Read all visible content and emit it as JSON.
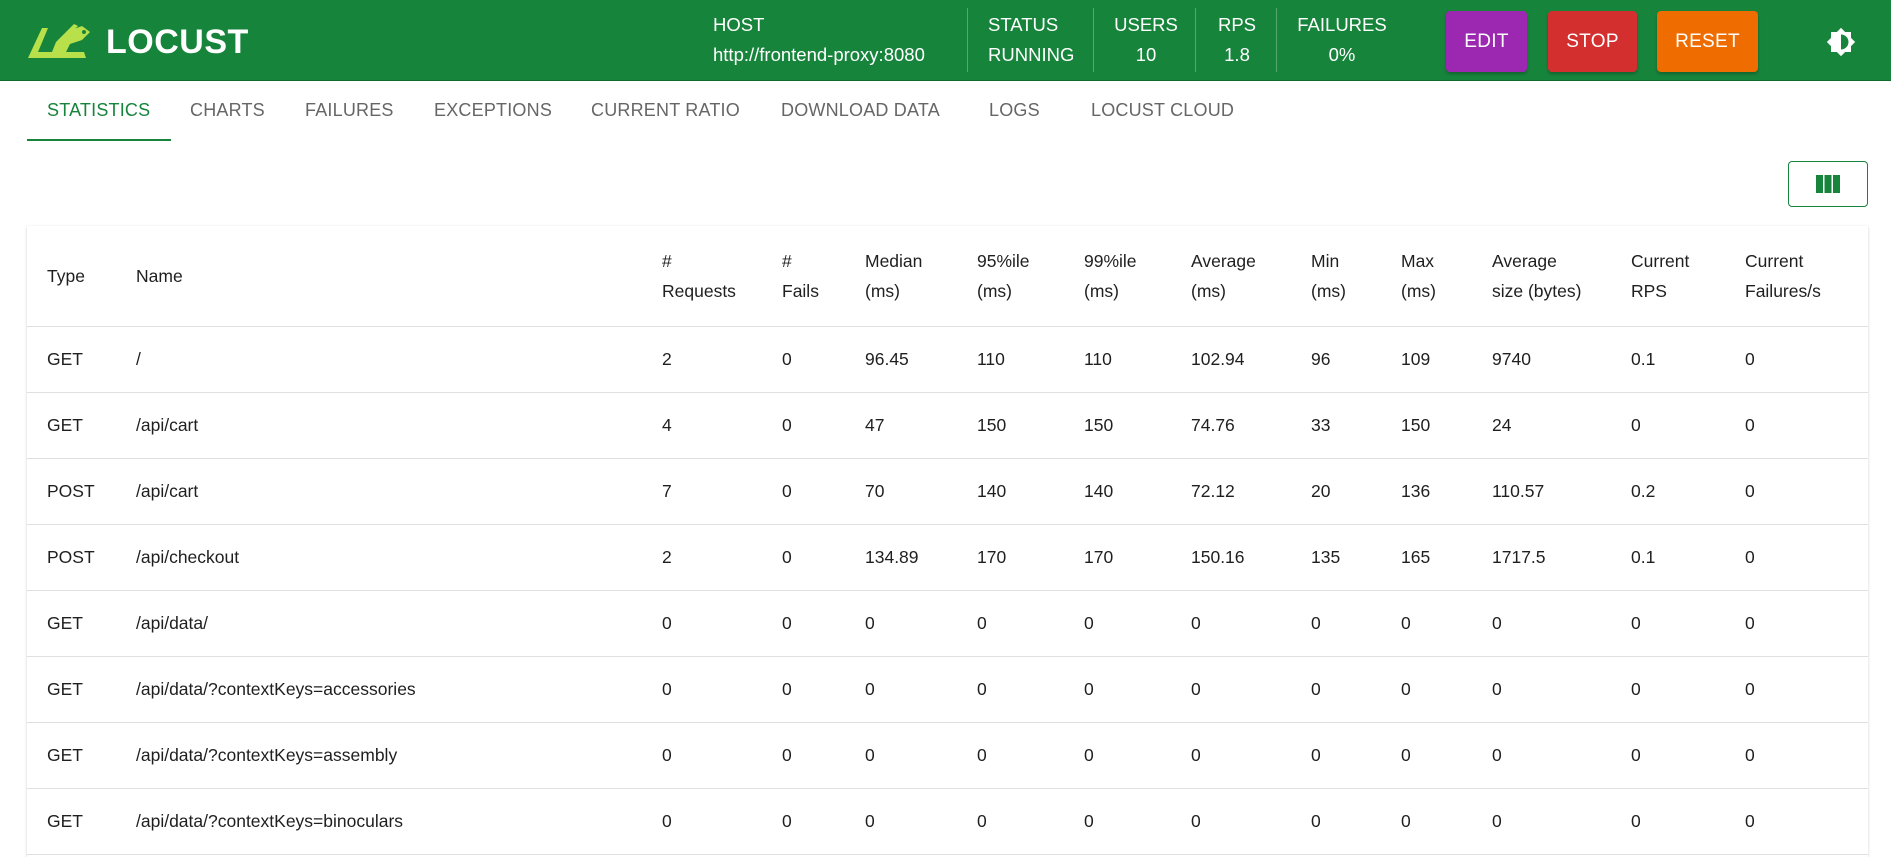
{
  "app": {
    "logo_text": "LOCUST"
  },
  "header": {
    "host_label": "HOST",
    "host_value": "http://frontend-proxy:8080",
    "status_label": "STATUS",
    "status_value": "RUNNING",
    "users_label": "USERS",
    "users_value": "10",
    "rps_label": "RPS",
    "rps_value": "1.8",
    "failures_label": "FAILURES",
    "failures_value": "0%",
    "edit_label": "EDIT",
    "stop_label": "STOP",
    "reset_label": "RESET",
    "colors": {
      "bar": "#17843c",
      "edit": "#9c27b0",
      "stop": "#d32f2f",
      "reset": "#ef6c00"
    }
  },
  "tabs": [
    {
      "label": "STATISTICS"
    },
    {
      "label": "CHARTS"
    },
    {
      "label": "FAILURES"
    },
    {
      "label": "EXCEPTIONS"
    },
    {
      "label": "CURRENT RATIO"
    },
    {
      "label": "DOWNLOAD DATA"
    },
    {
      "label": "LOGS"
    },
    {
      "label": "LOCUST CLOUD"
    }
  ],
  "active_tab": "STATISTICS",
  "columns_button_icon": "view-column-icon",
  "theme_toggle_icon": "brightness-icon",
  "table": {
    "headers": [
      [
        "Type"
      ],
      [
        "Name"
      ],
      [
        "#",
        "Requests"
      ],
      [
        "#",
        "Fails"
      ],
      [
        "Median",
        "(ms)"
      ],
      [
        "95%ile",
        "(ms)"
      ],
      [
        "99%ile",
        "(ms)"
      ],
      [
        "Average",
        "(ms)"
      ],
      [
        "Min",
        "(ms)"
      ],
      [
        "Max",
        "(ms)"
      ],
      [
        "Average",
        "size (bytes)"
      ],
      [
        "Current",
        "RPS"
      ],
      [
        "Current",
        "Failures/s"
      ]
    ],
    "rows": [
      [
        "GET",
        "/",
        "2",
        "0",
        "96.45",
        "110",
        "110",
        "102.94",
        "96",
        "109",
        "9740",
        "0.1",
        "0"
      ],
      [
        "GET",
        "/api/cart",
        "4",
        "0",
        "47",
        "150",
        "150",
        "74.76",
        "33",
        "150",
        "24",
        "0",
        "0"
      ],
      [
        "POST",
        "/api/cart",
        "7",
        "0",
        "70",
        "140",
        "140",
        "72.12",
        "20",
        "136",
        "110.57",
        "0.2",
        "0"
      ],
      [
        "POST",
        "/api/checkout",
        "2",
        "0",
        "134.89",
        "170",
        "170",
        "150.16",
        "135",
        "165",
        "1717.5",
        "0.1",
        "0"
      ],
      [
        "GET",
        "/api/data/",
        "0",
        "0",
        "0",
        "0",
        "0",
        "0",
        "0",
        "0",
        "0",
        "0",
        "0"
      ],
      [
        "GET",
        "/api/data/?contextKeys=accessories",
        "0",
        "0",
        "0",
        "0",
        "0",
        "0",
        "0",
        "0",
        "0",
        "0",
        "0"
      ],
      [
        "GET",
        "/api/data/?contextKeys=assembly",
        "0",
        "0",
        "0",
        "0",
        "0",
        "0",
        "0",
        "0",
        "0",
        "0",
        "0"
      ],
      [
        "GET",
        "/api/data/?contextKeys=binoculars",
        "0",
        "0",
        "0",
        "0",
        "0",
        "0",
        "0",
        "0",
        "0",
        "0",
        "0"
      ]
    ]
  }
}
